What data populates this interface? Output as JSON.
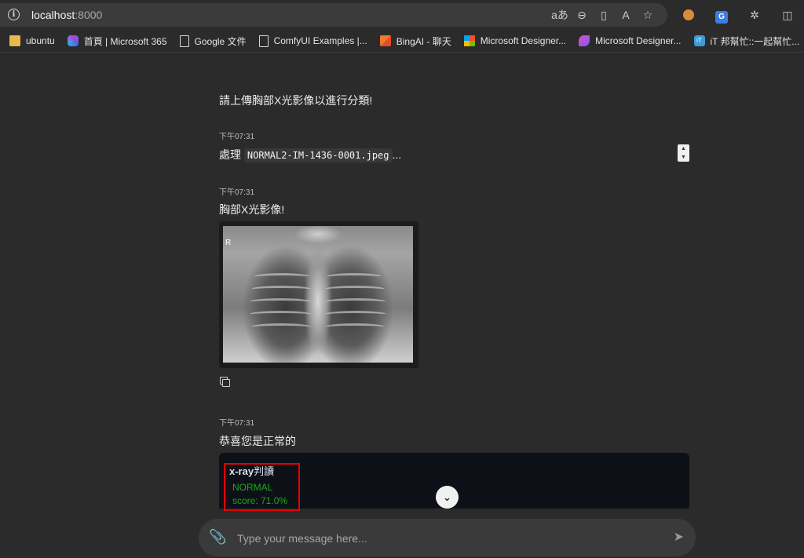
{
  "browser": {
    "url_host": "localhost",
    "url_port": ":8000",
    "bookmarks": [
      {
        "label": "ubuntu",
        "icon": "folder-icon"
      },
      {
        "label": "首頁 | Microsoft 365",
        "icon": "microsoft365-icon"
      },
      {
        "label": "Google 文件",
        "icon": "document-icon"
      },
      {
        "label": "ComfyUI Examples |...",
        "icon": "document-icon"
      },
      {
        "label": "BingAI - 聊天",
        "icon": "bing-icon"
      },
      {
        "label": "Microsoft Designer...",
        "icon": "microsoft-logo-icon"
      },
      {
        "label": "Microsoft Designer...",
        "icon": "designer-icon"
      },
      {
        "label": "iT 邦幫忙::一起幫忙...",
        "icon": "ithome-icon"
      }
    ]
  },
  "chat": {
    "intro": "請上傳胸部X光影像以進行分類!",
    "messages": [
      {
        "time": "下午07:31",
        "prefix": "處理",
        "filename": "NORMAL2-IM-1436-0001.jpeg",
        "suffix": "..."
      },
      {
        "time": "下午07:31",
        "text": "胸部X光影像!",
        "image_marker": "R"
      },
      {
        "time": "下午07:31",
        "text": "恭喜您是正常的"
      }
    ],
    "result": {
      "title_latin": "x-ray",
      "title_cjk": "判讀",
      "label": "NORMAL",
      "score": "score: 71.0%"
    }
  },
  "composer": {
    "placeholder": "Type your message here..."
  },
  "colors": {
    "background": "#2b2b2b",
    "result_card": "#0d1117",
    "highlight": "#e60000",
    "result_text": "#1ea81e"
  }
}
